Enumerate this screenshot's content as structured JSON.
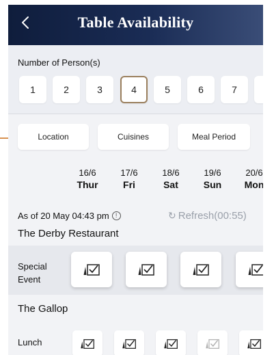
{
  "header": {
    "title": "Table Availability",
    "back_icon": "chevron-left-icon"
  },
  "persons": {
    "label": "Number of Person(s)",
    "options": [
      "1",
      "2",
      "3",
      "4",
      "5",
      "6",
      "7"
    ],
    "selected": "4"
  },
  "filters": {
    "location": "Location",
    "cuisines": "Cuisines",
    "meal_period": "Meal Period"
  },
  "dates": [
    {
      "date": "16/6",
      "day": "Thur"
    },
    {
      "date": "17/6",
      "day": "Fri"
    },
    {
      "date": "18/6",
      "day": "Sat"
    },
    {
      "date": "19/6",
      "day": "Sun"
    },
    {
      "date": "20/6",
      "day": "Mon"
    }
  ],
  "status": {
    "as_of": "As of 20 May 04:43 pm",
    "refresh": "Refresh(00:55)"
  },
  "restaurants": [
    {
      "name": "The Derby Restaurant",
      "rows": [
        {
          "label_line1": "Special",
          "label_line2": "Event"
        }
      ]
    },
    {
      "name": "The Gallop",
      "rows": [
        {
          "label": "Lunch"
        }
      ]
    }
  ],
  "colors": {
    "header": "#0f1d3c",
    "accent": "#9a7f5d",
    "refresh": "#9aa0aa"
  }
}
